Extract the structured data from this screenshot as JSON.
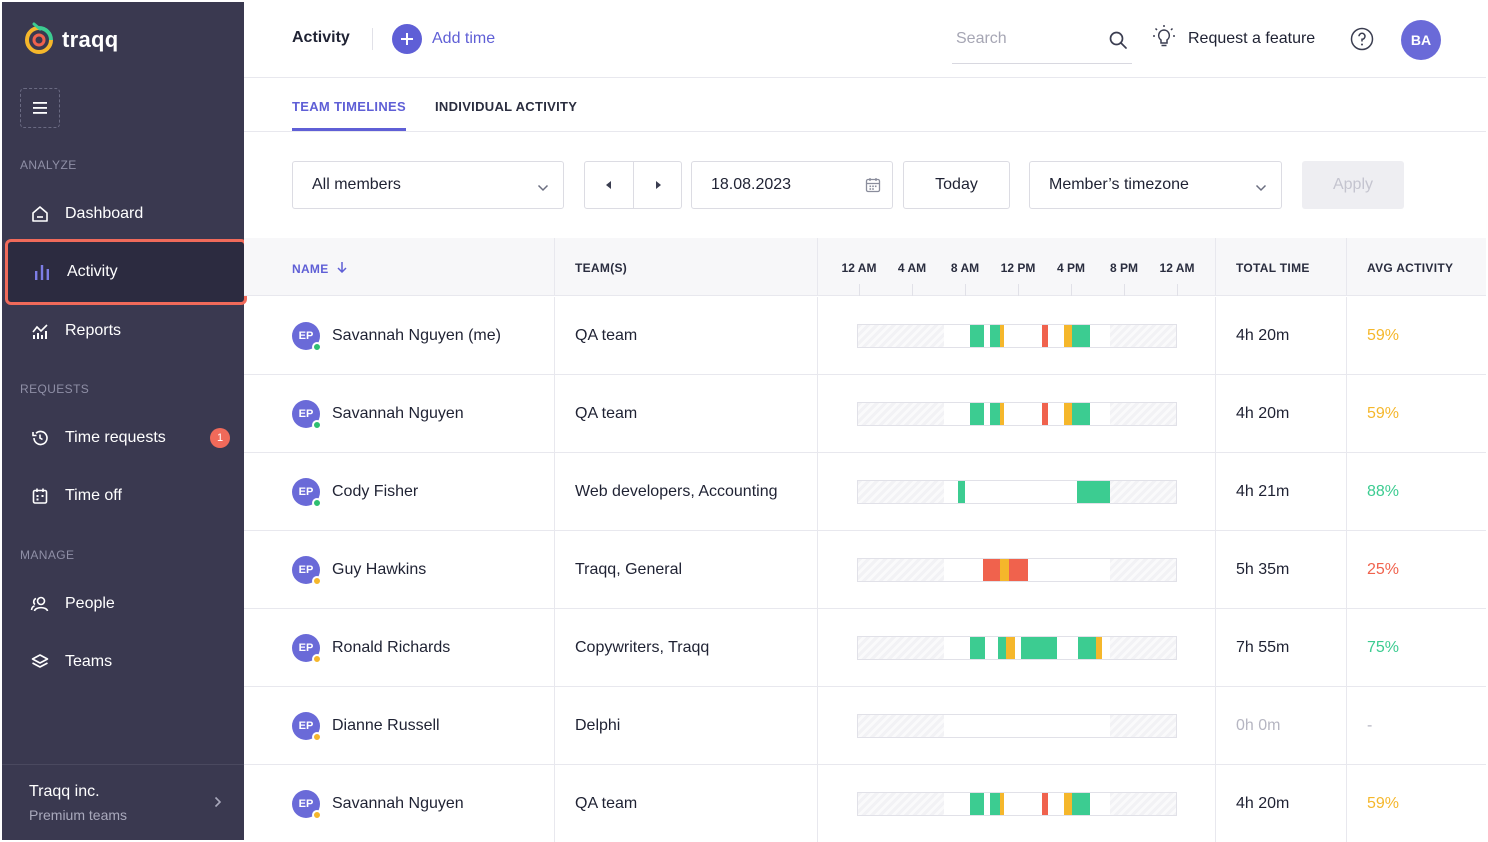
{
  "app": {
    "logo_text": "traqq"
  },
  "sidebar": {
    "sections": [
      {
        "label": "ANALYZE"
      },
      {
        "label": "REQUESTS"
      },
      {
        "label": "MANAGE"
      }
    ],
    "items": [
      {
        "label": "Dashboard",
        "icon": "home-icon"
      },
      {
        "label": "Activity",
        "icon": "bar-chart-icon",
        "active": true
      },
      {
        "label": "Reports",
        "icon": "reports-chart-icon"
      },
      {
        "label": "Time requests",
        "icon": "history-icon",
        "badge": "1"
      },
      {
        "label": "Time off",
        "icon": "calendar-icon"
      },
      {
        "label": "People",
        "icon": "people-icon"
      },
      {
        "label": "Teams",
        "icon": "layers-icon"
      }
    ],
    "org": {
      "name": "Traqq inc.",
      "plan": "Premium teams"
    }
  },
  "header": {
    "title": "Activity",
    "add_time_label": "Add time",
    "search_placeholder": "Search",
    "request_feature_label": "Request a feature",
    "user_initials": "BA"
  },
  "tabs": [
    {
      "label": "TEAM TIMELINES",
      "active": true
    },
    {
      "label": "INDIVIDUAL ACTIVITY",
      "active": false
    }
  ],
  "filters": {
    "members": "All members",
    "date": "18.08.2023",
    "today_label": "Today",
    "timezone": "Member’s timezone",
    "apply_label": "Apply"
  },
  "table": {
    "headers": {
      "name": "NAME",
      "teams": "TEAM(S)",
      "total": "TOTAL TIME",
      "avg": "AVG ACTIVITY"
    },
    "hours": [
      "12 AM",
      "4 AM",
      "8 AM",
      "12 PM",
      "4 PM",
      "8 PM",
      "12 AM"
    ],
    "rows": [
      {
        "initials": "EP",
        "status": "online",
        "name": "Savannah Nguyen (me)",
        "teams": "QA team",
        "total": "4h 20m",
        "avg": "59%",
        "avg_level": "medium",
        "timeline": "a"
      },
      {
        "initials": "EP",
        "status": "online",
        "name": "Savannah Nguyen",
        "teams": "QA team",
        "total": "4h 20m",
        "avg": "59%",
        "avg_level": "medium",
        "timeline": "a"
      },
      {
        "initials": "EP",
        "status": "online",
        "name": "Cody Fisher",
        "teams": "Web developers, Accounting",
        "total": "4h 21m",
        "avg": "88%",
        "avg_level": "high",
        "timeline": "b"
      },
      {
        "initials": "EP",
        "status": "away",
        "name": "Guy Hawkins",
        "teams": "Traqq, General",
        "total": "5h 35m",
        "avg": "25%",
        "avg_level": "low",
        "timeline": "c"
      },
      {
        "initials": "EP",
        "status": "away",
        "name": "Ronald Richards",
        "teams": "Copywriters, Traqq",
        "total": "7h 55m",
        "avg": "75%",
        "avg_level": "high",
        "timeline": "d"
      },
      {
        "initials": "EP",
        "status": "away",
        "name": "Dianne Russell",
        "teams": "Delphi",
        "total": "0h 0m",
        "avg": "-",
        "avg_level": "none",
        "timeline": "e"
      },
      {
        "initials": "EP",
        "status": "away",
        "name": "Savannah Nguyen",
        "teams": "QA team",
        "total": "4h 20m",
        "avg": "59%",
        "avg_level": "medium",
        "timeline": "a"
      }
    ]
  },
  "colors": {
    "accent": "#5f5fd6",
    "sidebar_bg": "#3a3950",
    "highlight": "#f06a5a",
    "high": "#3ccc91",
    "medium": "#f5b72b",
    "low": "#f0624d",
    "online": "#2fbf71",
    "away": "#f5b72b"
  }
}
